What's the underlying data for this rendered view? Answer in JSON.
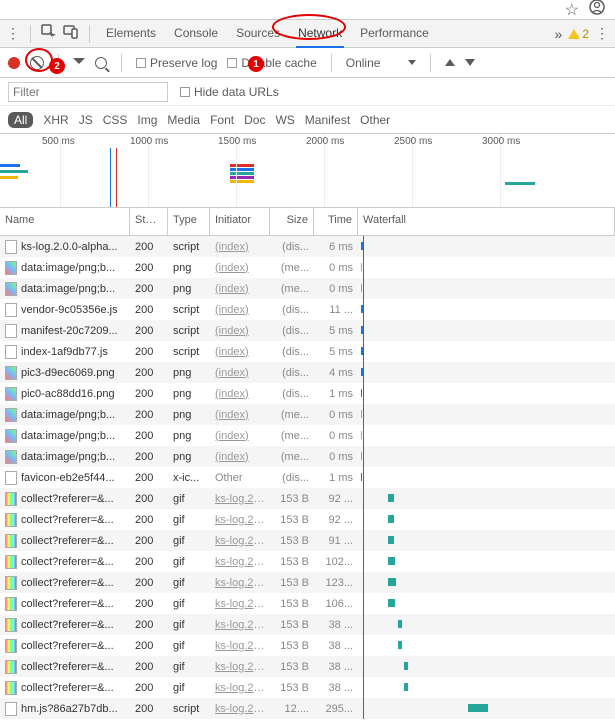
{
  "browserBar": {
    "star": "☆",
    "avatar": "◯"
  },
  "toolbar1": {
    "tabs": [
      "Elements",
      "Console",
      "Sources",
      "Network",
      "Performance"
    ],
    "activeTab": 3,
    "warnCount": "2"
  },
  "toolbar2": {
    "preserve": "Preserve log",
    "disableCache": "Disable cache",
    "online": "Online"
  },
  "filterRow": {
    "placeholder": "Filter",
    "hideUrls": "Hide data URLs"
  },
  "types": [
    "All",
    "XHR",
    "JS",
    "CSS",
    "Img",
    "Media",
    "Font",
    "Doc",
    "WS",
    "Manifest",
    "Other"
  ],
  "activeType": 0,
  "timeline": {
    "ticks": [
      "500 ms",
      "1000 ms",
      "1500 ms",
      "2000 ms",
      "2500 ms",
      "3000 ms"
    ]
  },
  "columns": {
    "name": "Name",
    "status": "Stat...",
    "type": "Type",
    "initiator": "Initiator",
    "size": "Size",
    "time": "Time",
    "waterfall": "Waterfall"
  },
  "rows": [
    {
      "icon": "js",
      "name": "ks-log.2.0.0-alpha...",
      "status": "200",
      "type": "script",
      "init": "(index)",
      "size": "(dis...",
      "time": "6 ms",
      "wf": {
        "l": 3,
        "w": 2,
        "c": "blue"
      }
    },
    {
      "icon": "png",
      "name": "data:image/png;b...",
      "status": "200",
      "type": "png",
      "init": "(index)",
      "size": "(me...",
      "time": "0 ms",
      "wf": {
        "l": 3,
        "w": 1,
        "c": "lblue"
      }
    },
    {
      "icon": "png",
      "name": "data:image/png;b...",
      "status": "200",
      "type": "png",
      "init": "(index)",
      "size": "(me...",
      "time": "0 ms",
      "wf": {
        "l": 3,
        "w": 1,
        "c": "lblue"
      }
    },
    {
      "icon": "js",
      "name": "vendor-9c05356e.js",
      "status": "200",
      "type": "script",
      "init": "(index)",
      "size": "(dis...",
      "time": "11 ...",
      "wf": {
        "l": 3,
        "w": 2,
        "c": "blue"
      }
    },
    {
      "icon": "js",
      "name": "manifest-20c7209...",
      "status": "200",
      "type": "script",
      "init": "(index)",
      "size": "(dis...",
      "time": "5 ms",
      "wf": {
        "l": 3,
        "w": 2,
        "c": "blue"
      }
    },
    {
      "icon": "js",
      "name": "index-1af9db77.js",
      "status": "200",
      "type": "script",
      "init": "(index)",
      "size": "(dis...",
      "time": "5 ms",
      "wf": {
        "l": 3,
        "w": 2,
        "c": "blue"
      }
    },
    {
      "icon": "png",
      "name": "pic3-d9ec6069.png",
      "status": "200",
      "type": "png",
      "init": "(index)",
      "size": "(dis...",
      "time": "4 ms",
      "wf": {
        "l": 3,
        "w": 2,
        "c": "blue"
      }
    },
    {
      "icon": "png",
      "name": "pic0-ac88dd16.png",
      "status": "200",
      "type": "png",
      "init": "(index)",
      "size": "(dis...",
      "time": "1 ms",
      "wf": {
        "l": 3,
        "w": 1,
        "c": "blue"
      }
    },
    {
      "icon": "png",
      "name": "data:image/png;b...",
      "status": "200",
      "type": "png",
      "init": "(index)",
      "size": "(me...",
      "time": "0 ms",
      "wf": {
        "l": 3,
        "w": 1,
        "c": "lblue"
      }
    },
    {
      "icon": "png",
      "name": "data:image/png;b...",
      "status": "200",
      "type": "png",
      "init": "(index)",
      "size": "(me...",
      "time": "0 ms",
      "wf": {
        "l": 3,
        "w": 1,
        "c": "lblue"
      }
    },
    {
      "icon": "png",
      "name": "data:image/png;b...",
      "status": "200",
      "type": "png",
      "init": "(index)",
      "size": "(me...",
      "time": "0 ms",
      "wf": {
        "l": 3,
        "w": 1,
        "c": "lblue"
      }
    },
    {
      "icon": "js",
      "name": "favicon-eb2e5f44...",
      "status": "200",
      "type": "x-ic...",
      "init": "Other",
      "size": "(dis...",
      "time": "1 ms",
      "wf": {
        "l": 3,
        "w": 1,
        "c": "blue"
      },
      "initPlain": true
    },
    {
      "icon": "gif",
      "name": "collect?referer=&...",
      "status": "200",
      "type": "gif",
      "init": "ks-log.2....",
      "size": "153 B",
      "time": "92 ...",
      "wf": {
        "l": 30,
        "w": 6,
        "c": "teal"
      }
    },
    {
      "icon": "gif",
      "name": "collect?referer=&...",
      "status": "200",
      "type": "gif",
      "init": "ks-log.2....",
      "size": "153 B",
      "time": "92 ...",
      "wf": {
        "l": 30,
        "w": 6,
        "c": "teal"
      }
    },
    {
      "icon": "gif",
      "name": "collect?referer=&...",
      "status": "200",
      "type": "gif",
      "init": "ks-log.2....",
      "size": "153 B",
      "time": "91 ...",
      "wf": {
        "l": 30,
        "w": 6,
        "c": "teal"
      }
    },
    {
      "icon": "gif",
      "name": "collect?referer=&...",
      "status": "200",
      "type": "gif",
      "init": "ks-log.2....",
      "size": "153 B",
      "time": "102...",
      "wf": {
        "l": 30,
        "w": 7,
        "c": "teal"
      }
    },
    {
      "icon": "gif",
      "name": "collect?referer=&...",
      "status": "200",
      "type": "gif",
      "init": "ks-log.2....",
      "size": "153 B",
      "time": "123...",
      "wf": {
        "l": 30,
        "w": 8,
        "c": "teal"
      }
    },
    {
      "icon": "gif",
      "name": "collect?referer=&...",
      "status": "200",
      "type": "gif",
      "init": "ks-log.2....",
      "size": "153 B",
      "time": "106...",
      "wf": {
        "l": 30,
        "w": 7,
        "c": "teal"
      }
    },
    {
      "icon": "gif",
      "name": "collect?referer=&...",
      "status": "200",
      "type": "gif",
      "init": "ks-log.2....",
      "size": "153 B",
      "time": "38 ...",
      "wf": {
        "l": 40,
        "w": 4,
        "c": "teal"
      }
    },
    {
      "icon": "gif",
      "name": "collect?referer=&...",
      "status": "200",
      "type": "gif",
      "init": "ks-log.2....",
      "size": "153 B",
      "time": "38 ...",
      "wf": {
        "l": 40,
        "w": 4,
        "c": "teal"
      }
    },
    {
      "icon": "gif",
      "name": "collect?referer=&...",
      "status": "200",
      "type": "gif",
      "init": "ks-log.2....",
      "size": "153 B",
      "time": "38 ...",
      "wf": {
        "l": 46,
        "w": 4,
        "c": "teal"
      }
    },
    {
      "icon": "gif",
      "name": "collect?referer=&...",
      "status": "200",
      "type": "gif",
      "init": "ks-log.2....",
      "size": "153 B",
      "time": "38 ...",
      "wf": {
        "l": 46,
        "w": 4,
        "c": "teal"
      }
    },
    {
      "icon": "js",
      "name": "hm.js?86a27b7db...",
      "status": "200",
      "type": "script",
      "init": "ks-log.2....",
      "size": "12....",
      "time": "295...",
      "wf": {
        "l": 110,
        "w": 20,
        "c": "teal"
      }
    }
  ],
  "annotations": {
    "label1": "1",
    "label2": "2"
  }
}
